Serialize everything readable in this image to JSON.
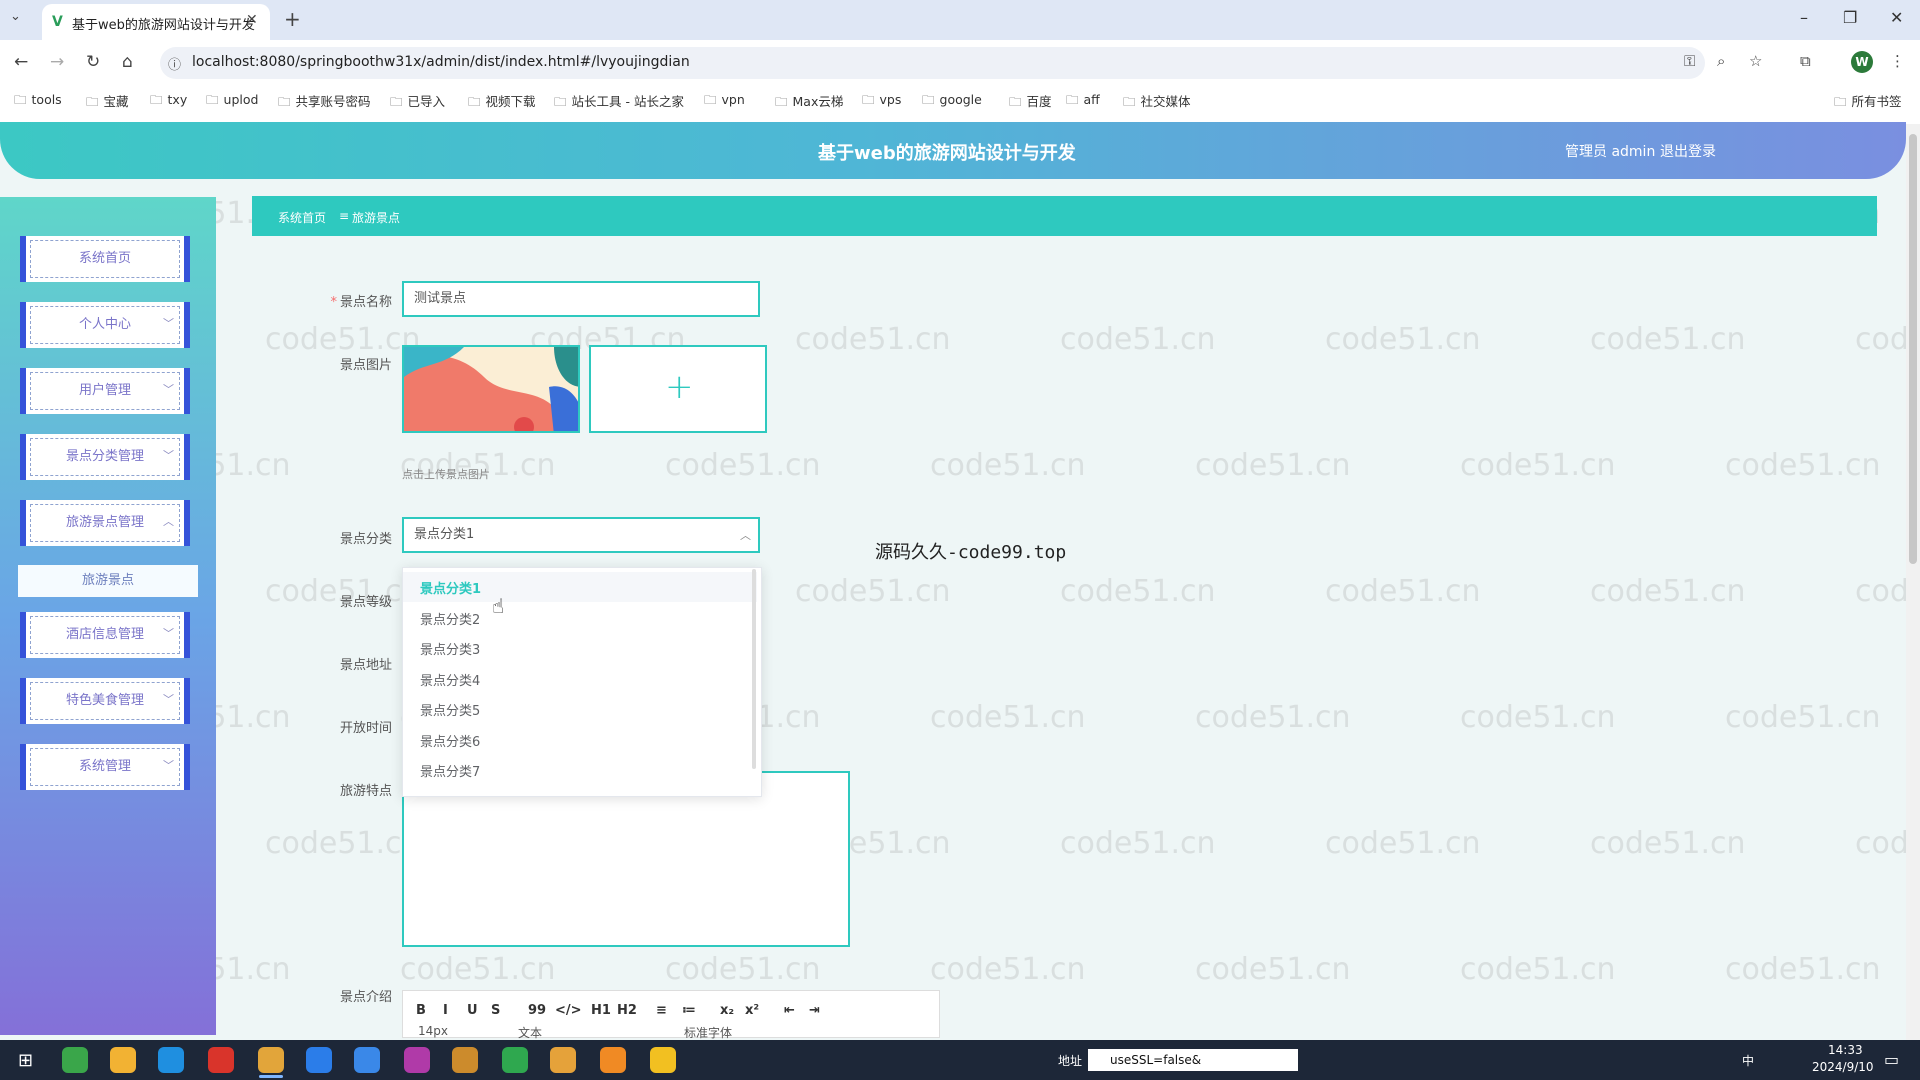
{
  "browser": {
    "tab_title": "基于web的旅游网站设计与开发",
    "url": "localhost:8080/springboothw31x/admin/dist/index.html#/lvyoujingdian",
    "bookmarks": [
      "tools",
      "宝藏",
      "txy",
      "uplod",
      "共享账号密码",
      "已导入",
      "视频下载",
      "站长工具 - 站长之家",
      "vpn",
      "Max云梯",
      "vps",
      "google",
      "百度",
      "aff",
      "社交媒体"
    ],
    "all_bookmarks": "所有书签",
    "profile_initial": "W"
  },
  "header": {
    "title": "基于web的旅游网站设计与开发",
    "user": "管理员 admin",
    "logout": "退出登录"
  },
  "sidebar": {
    "items": [
      "系统首页",
      "个人中心",
      "用户管理",
      "景点分类管理",
      "旅游景点管理",
      "酒店信息管理",
      "特色美食管理",
      "系统管理"
    ],
    "submenu": "旅游景点"
  },
  "breadcrumb": {
    "home": "系统首页",
    "sep": "≡",
    "current": "旅游景点"
  },
  "form": {
    "name_label": "景点名称",
    "name_value": "测试景点",
    "image_label": "景点图片",
    "upload_hint": "点击上传景点图片",
    "category_label": "景点分类",
    "category_value": "景点分类1",
    "level_label": "景点等级",
    "address_label": "景点地址",
    "open_label": "开放时间",
    "features_label": "旅游特点",
    "intro_label": "景点介绍"
  },
  "dropdown": {
    "options": [
      "景点分类1",
      "景点分类2",
      "景点分类3",
      "景点分类4",
      "景点分类5",
      "景点分类6",
      "景点分类7"
    ],
    "selected": "景点分类1"
  },
  "editor": {
    "buttons": [
      "B",
      "I",
      "U",
      "S",
      "99",
      "</>",
      "H1",
      "H2",
      "≡",
      "≔",
      "x₂",
      "x²",
      "⇤",
      "⇥"
    ],
    "font_size": "14px",
    "text_style": "文本",
    "font_family": "标准字体"
  },
  "overlay_text": "源码久久-code99.top",
  "watermark": "code51.cn",
  "taskbar": {
    "address_label": "地址",
    "address_value": "useSSL=false&",
    "time": "14:33",
    "date": "2024/9/10",
    "ime": "中"
  },
  "colors": {
    "accent": "#2ec9bf",
    "sidebar_border": "#3553d9"
  }
}
